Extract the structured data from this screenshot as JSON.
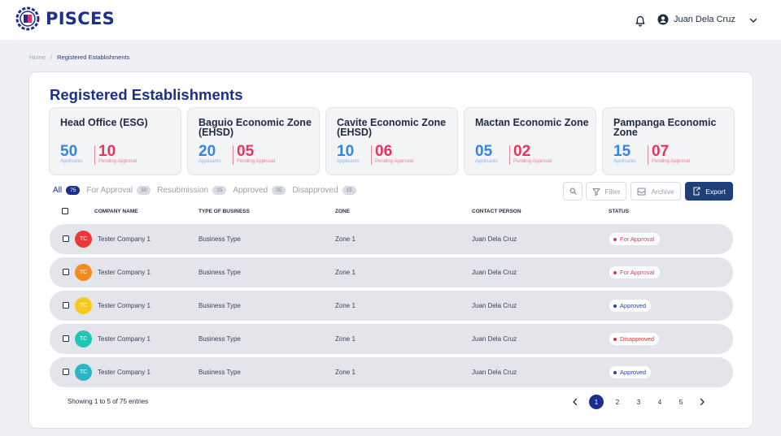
{
  "app": {
    "brand": "PISCES"
  },
  "user": {
    "name": "Juan Dela Cruz"
  },
  "breadcrumb": {
    "home": "Home",
    "separator": "/",
    "current": "Registered Establishments"
  },
  "page": {
    "title": "Registered Establishments"
  },
  "stats": [
    {
      "title": "Head Office (ESG)",
      "applicants": "50",
      "applicants_label": "Applicants",
      "pending": "10",
      "pending_label": "Pending Approval"
    },
    {
      "title": "Baguio Economic Zone (EHSD)",
      "applicants": "20",
      "applicants_label": "Applicants",
      "pending": "05",
      "pending_label": "Pending Approval"
    },
    {
      "title": "Cavite Economic Zone (EHSD)",
      "applicants": "10",
      "applicants_label": "Applicants",
      "pending": "06",
      "pending_label": "Pending Approval"
    },
    {
      "title": "Mactan Economic Zone",
      "applicants": "05",
      "applicants_label": "Applicants",
      "pending": "02",
      "pending_label": "Pending Approval"
    },
    {
      "title": "Pampanga Economic Zone",
      "applicants": "15",
      "applicants_label": "Applicants",
      "pending": "07",
      "pending_label": "Pending Approval"
    }
  ],
  "tabs": [
    {
      "label": "All",
      "count": "75"
    },
    {
      "label": "For Approval",
      "count": "30"
    },
    {
      "label": "Resubmission",
      "count": "15"
    },
    {
      "label": "Approved",
      "count": "35"
    },
    {
      "label": "Disapproved",
      "count": "15"
    }
  ],
  "toolbar": {
    "filter": "Filter",
    "archive": "Archive",
    "export": "Export"
  },
  "table": {
    "columns": {
      "company": "COMPANY NAME",
      "business": "TYPE OF BUSINESS",
      "zone": "ZONE",
      "contact": "CONTACT PERSON",
      "status": "STATUS"
    },
    "rows": [
      {
        "initials": "TC",
        "avatar_color": "#e83a3a",
        "company": "Tester Company 1",
        "business": "Business Type",
        "zone": "Zone 1",
        "contact": "Juan Dela Cruz",
        "status": "For Approval",
        "status_color": "#e8345c"
      },
      {
        "initials": "TC",
        "avatar_color": "#f28c1a",
        "company": "Tester Company 1",
        "business": "Business Type",
        "zone": "Zone 1",
        "contact": "Juan Dela Cruz",
        "status": "For Approval",
        "status_color": "#e8345c"
      },
      {
        "initials": "TC",
        "avatar_color": "#f7c81e",
        "company": "Tester Company 1",
        "business": "Business Type",
        "zone": "Zone 1",
        "contact": "Juan Dela Cruz",
        "status": "Approved",
        "status_color": "#2a3fb8"
      },
      {
        "initials": "TC",
        "avatar_color": "#1cc7b3",
        "company": "Tester Company 1",
        "business": "Business Type",
        "zone": "Zone 1",
        "contact": "Juan Dela Cruz",
        "status": "Disapproved",
        "status_color": "#d93434"
      },
      {
        "initials": "TC",
        "avatar_color": "#2cb5c9",
        "company": "Tester Company 1",
        "business": "Business Type",
        "zone": "Zone 1",
        "contact": "Juan Dela Cruz",
        "status": "Approved",
        "status_color": "#2a3fb8"
      }
    ]
  },
  "footer": {
    "showing": "Showing 1 to 5 of 75 entries"
  },
  "pagination": {
    "pages": [
      "1",
      "2",
      "3",
      "4",
      "5"
    ],
    "current": "1"
  },
  "colors": {
    "brand": "#1b2f8f",
    "applicants": "#2f86e8",
    "pending": "#e8345c",
    "export_button": "#1e3f7a"
  }
}
